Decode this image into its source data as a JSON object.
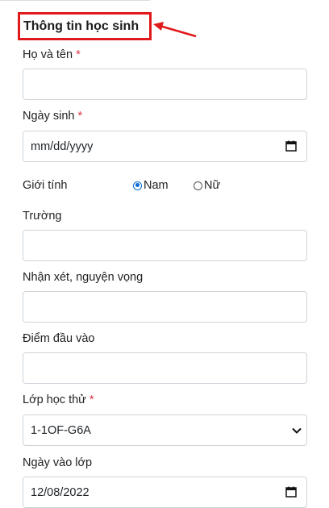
{
  "section_title": "Thông tin học sinh",
  "required_mark": "*",
  "fields": {
    "name": {
      "label": "Họ và tên",
      "value": ""
    },
    "dob": {
      "label": "Ngày sinh",
      "value": "mm/dd/yyyy"
    },
    "gender": {
      "label": "Giới tính",
      "options": [
        "Nam",
        "Nữ"
      ],
      "selected": "Nam"
    },
    "school": {
      "label": "Trường",
      "value": ""
    },
    "comments": {
      "label": "Nhận xét, nguyện vọng",
      "value": ""
    },
    "entry_score": {
      "label": "Điểm đầu vào",
      "value": ""
    },
    "trial_class": {
      "label": "Lớp học thử",
      "value": "1-1OF-G6A"
    },
    "class_date": {
      "label": "Ngày vào lớp",
      "value": "12/08/2022"
    }
  },
  "colors": {
    "highlight": "#e0191b",
    "required": "#dc3545",
    "radio_accent": "#0a6bd8"
  }
}
